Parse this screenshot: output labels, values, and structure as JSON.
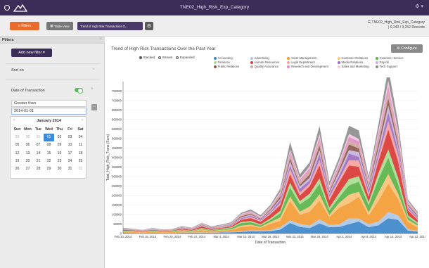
{
  "app": {
    "title": "TNE02_High_Risk_Exp_Category",
    "logo_icon": "mountain-logo-icon"
  },
  "toolbar": {
    "filters_label": "Filters",
    "table_view_label": "Table View",
    "chart_tab_label": "Trend of High Risk Transactions O...",
    "dataset_name": "TNE02_High_Risk_Exp_Category",
    "record_count": "| 9,240 / 9,252 Records"
  },
  "sidebar": {
    "header": "Filters",
    "add_filter_label": "Add new filter",
    "sort_label": "Sort on",
    "filter_field": "Date of Transaction",
    "filter_condition": "Greater than",
    "filter_value": "2014-01-01",
    "calendar": {
      "month_label": "January 2014",
      "prev": "‹",
      "next": "›",
      "weekdays": [
        "Sun",
        "Mon",
        "Tue",
        "Wed",
        "Thu",
        "Fri",
        "Sat"
      ],
      "weeks": [
        [
          "29",
          "30",
          "31",
          "01",
          "02",
          "03",
          "04"
        ],
        [
          "05",
          "06",
          "07",
          "08",
          "09",
          "10",
          "11"
        ],
        [
          "12",
          "13",
          "14",
          "15",
          "16",
          "17",
          "18"
        ],
        [
          "19",
          "20",
          "21",
          "22",
          "23",
          "24",
          "25"
        ],
        [
          "26",
          "27",
          "28",
          "29",
          "30",
          "31",
          "01"
        ]
      ],
      "selected": "01"
    }
  },
  "main": {
    "chart_title": "Trend of High Risk Transactions Over the Past Year",
    "configure_label": "Configure",
    "modes": [
      {
        "label": "Stacked",
        "selected": true
      },
      {
        "label": "Stream",
        "selected": false
      },
      {
        "label": "Expanded",
        "selected": false
      }
    ]
  },
  "chart_data": {
    "type": "area",
    "title": "Trend of High Risk Transactions Over the Past Year",
    "xlabel": "Date of Transaction",
    "ylabel": "Total_High_Risk_Trans (Sum)",
    "ylim": [
      0,
      800000
    ],
    "yticks": [
      "0",
      "50000",
      "100000",
      "150000",
      "200000",
      "250000",
      "300000",
      "350000",
      "400000",
      "450000",
      "500000",
      "550000",
      "600000",
      "650000",
      "700000",
      "750000"
    ],
    "xticks": [
      "Feb 10, 2014",
      "Feb 15, 2014",
      "Feb 20, 2014",
      "Feb 27, 2014",
      "Mar 4, 2014",
      "Mar 10, 2014",
      "Mar 16, 2014",
      "Mar 22, 2014",
      "Mar 28, 2014",
      "Apr 2, 2014",
      "Apr 8, 2014",
      "Apr 14, 2014",
      "Apr 22, 2014"
    ],
    "legend": [
      {
        "name": "Accounting",
        "color": "#3d88c9"
      },
      {
        "name": "Advertising",
        "color": "#a9c8e8"
      },
      {
        "name": "Asset Management",
        "color": "#f39c34"
      },
      {
        "name": "Customer Relations",
        "color": "#f7c279"
      },
      {
        "name": "Customer Service",
        "color": "#5bb349"
      },
      {
        "name": "Finances",
        "color": "#a6dc8f"
      },
      {
        "name": "Human Resources",
        "color": "#d93a34"
      },
      {
        "name": "Legal Department",
        "color": "#f5a3a0"
      },
      {
        "name": "Media Relations",
        "color": "#9a6fc0"
      },
      {
        "name": "Payroll",
        "color": "#c9b4dd"
      },
      {
        "name": "Public Relations",
        "color": "#8c5a4e"
      },
      {
        "name": "Quality Assurance",
        "color": "#cfa99e"
      },
      {
        "name": "Research and Development",
        "color": "#e58bc6"
      },
      {
        "name": "Sales and Marketing",
        "color": "#f0c8dc"
      },
      {
        "name": "Tech Support",
        "color": "#8e8e8e"
      }
    ],
    "x": [
      "Feb 10",
      "Feb 13",
      "Feb 15",
      "Feb 18",
      "Feb 20",
      "Feb 23",
      "Feb 27",
      "Mar 1",
      "Mar 4",
      "Mar 7",
      "Mar 10",
      "Mar 13",
      "Mar 16",
      "Mar 18",
      "Mar 20",
      "Mar 22",
      "Mar 24",
      "Mar 26",
      "Mar 28",
      "Mar 30",
      "Apr 2",
      "Apr 4",
      "Apr 6",
      "Apr 8",
      "Apr 10",
      "Apr 12",
      "Apr 14",
      "Apr 16",
      "Apr 18",
      "Apr 20",
      "Apr 22"
    ],
    "totals": [
      30000,
      25000,
      20000,
      28000,
      22000,
      24000,
      38000,
      30000,
      55000,
      40000,
      45000,
      60000,
      110000,
      120000,
      95000,
      150000,
      250000,
      460000,
      320000,
      380000,
      520000,
      270000,
      400000,
      600000,
      520000,
      310000,
      580000,
      780000,
      580000,
      180000,
      120000
    ],
    "shares": [
      0.1,
      0.04,
      0.18,
      0.06,
      0.1,
      0.05,
      0.12,
      0.05,
      0.05,
      0.04,
      0.04,
      0.04,
      0.03,
      0.03,
      0.07
    ]
  }
}
